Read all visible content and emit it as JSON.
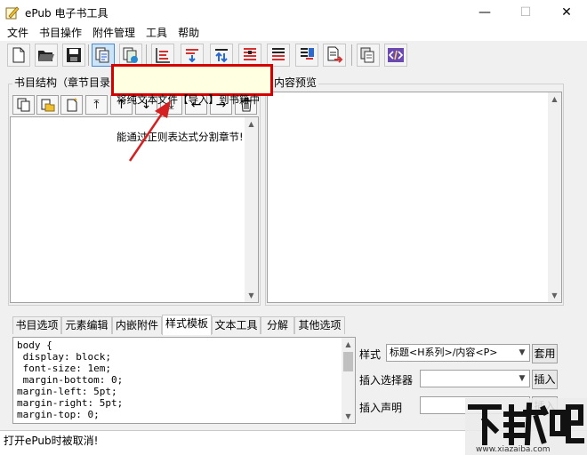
{
  "window": {
    "title": "ePub 电子书工具",
    "icon": "pencil-paper-icon",
    "controls": {
      "minimize": "—",
      "maximize": "☐",
      "close": "✕"
    }
  },
  "menu": [
    "文件",
    "书目操作",
    "附件管理",
    "工具",
    "帮助"
  ],
  "toolbar": {
    "icons": [
      "new-file-icon",
      "open-folder-icon",
      "save-icon",
      "import-text-icon",
      "export-icon",
      "list-icon",
      "list-down-icon",
      "list-up-icon",
      "list-red-icon",
      "list-split-icon",
      "list-merge-icon",
      "doc-arrow-icon",
      "copy-pages-icon",
      "code-icon"
    ],
    "accent": "#4a8ad4"
  },
  "tooltip": {
    "line1": "将纯文本文件【导入】到书籍中",
    "line2": "能通过正则表达式分割章节!",
    "border_color": "#d40000"
  },
  "left_panel": {
    "title": "书目结构（章节目录",
    "buttons": [
      "copy-icon",
      "paste-folder-icon",
      "new-page-icon",
      "move-top-icon",
      "move-up-icon",
      "move-down-icon",
      "move-bottom-icon",
      "move-left-icon",
      "move-right-icon",
      "delete-icon"
    ],
    "button_glyphs": [
      "",
      "",
      "",
      "⤒",
      "↑",
      "↓",
      "⤓",
      "←",
      "→",
      ""
    ]
  },
  "right_panel": {
    "title": "内容预览"
  },
  "tabs": {
    "items": [
      "书目选项",
      "元素编辑",
      "内嵌附件",
      "样式模板",
      "文本工具",
      "分解",
      "其他选项"
    ],
    "active": "样式模板"
  },
  "css_editor": {
    "content": "body {\n display: block;\n font-size: 1em;\n margin-bottom: 0;\nmargin-left: 5pt;\nmargin-right: 5pt;\nmargin-top: 0;"
  },
  "style_form": {
    "style_label": "样式",
    "style_value": "标题<H系列>/内容<P>",
    "apply_button": "套用",
    "selector_label": "插入选择器",
    "selector_value": "",
    "insert_button": "插入",
    "declaration_label": "插入声明",
    "declaration_value": "",
    "insert2_button": "插入"
  },
  "status": {
    "text": "打开ePub时被取消!"
  },
  "watermark": {
    "text": "下载吧",
    "url": "www.xiazaiba.com"
  }
}
